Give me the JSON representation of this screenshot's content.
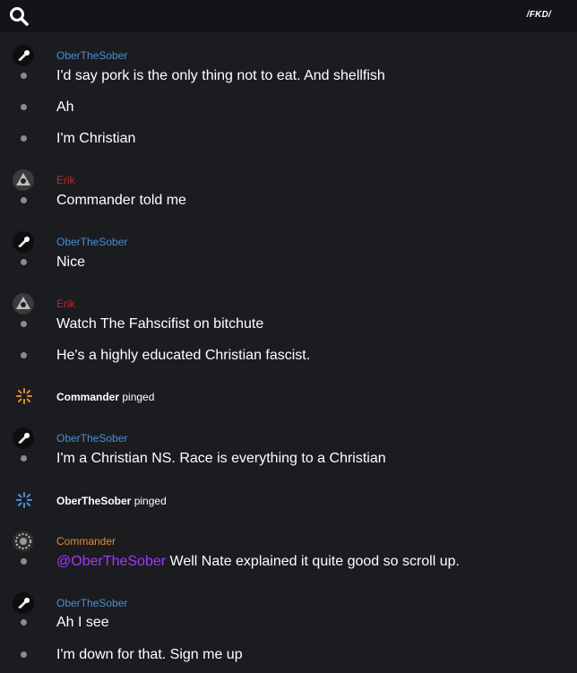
{
  "header": {
    "search_icon": "search-icon",
    "channel": "/FKD/"
  },
  "colors": {
    "background": "#1b1c20",
    "header_background": "#131417",
    "oberthesober": "#4a8fd6",
    "erik": "#c0262a",
    "commander": "#e08a2e",
    "mention": "#a238ff",
    "bullet": "#8a8b8e"
  },
  "messages": [
    {
      "author": "OberTheSober",
      "text": "I'd say pork is the only thing not to eat. And shellfish"
    },
    {
      "text": "Ah"
    },
    {
      "text": "I'm Christian"
    },
    {
      "author": "Erik",
      "text": "Commander told me"
    },
    {
      "author": "OberTheSober",
      "text": "Nice"
    },
    {
      "author": "Erik",
      "text": "Watch The Fahscifist on bitchute"
    },
    {
      "text": "He's a highly educated Christian fascist."
    },
    {
      "ping_user": "Commander",
      "ping_verb": "pinged"
    },
    {
      "author": "OberTheSober",
      "text": "I'm a Christian NS. Race is everything to a Christian"
    },
    {
      "ping_user": "OberTheSober",
      "ping_verb": "pinged"
    },
    {
      "author": "Commander",
      "mention": "@OberTheSober",
      "text": " Well Nate explained it quite good so scroll up."
    },
    {
      "author": "OberTheSober",
      "text": "Ah I see"
    },
    {
      "text": "I'm down for that. Sign me up"
    }
  ]
}
